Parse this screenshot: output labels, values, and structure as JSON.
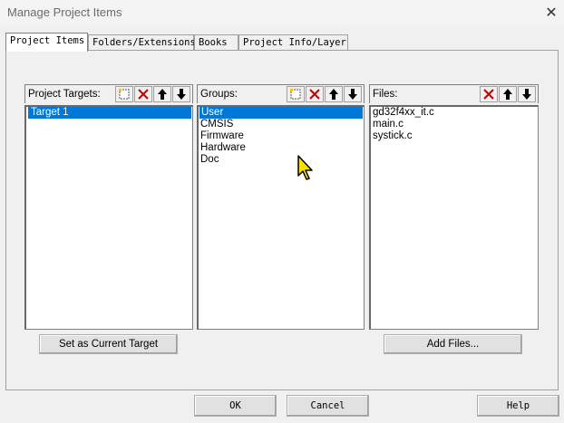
{
  "window": {
    "title": "Manage Project Items",
    "close_symbol": "✕"
  },
  "tabs": [
    {
      "label": "Project Items",
      "active": true
    },
    {
      "label": "Folders/Extensions",
      "active": false
    },
    {
      "label": "Books",
      "active": false
    },
    {
      "label": "Project Info/Layer",
      "active": false
    }
  ],
  "targets": {
    "label": "Project Targets:",
    "items": [
      "Target 1"
    ],
    "selected": "Target 1",
    "set_current_label": "Set as Current Target"
  },
  "groups": {
    "label": "Groups:",
    "items": [
      "User",
      "CMSIS",
      "Firmware",
      "Hardware",
      "Doc"
    ],
    "selected": "User"
  },
  "files": {
    "label": "Files:",
    "items": [
      "gd32f4xx_it.c",
      "main.c",
      "systick.c"
    ],
    "add_files_label": "Add Files..."
  },
  "footer": {
    "ok_label": "OK",
    "cancel_label": "Cancel",
    "help_label": "Help"
  },
  "colors": {
    "selection": "#0078d7",
    "delete_icon": "#c00000",
    "cursor": "#f5e000"
  },
  "icons": {
    "new": "new-item-icon",
    "delete": "delete-icon",
    "up": "move-up-icon",
    "down": "move-down-icon"
  }
}
